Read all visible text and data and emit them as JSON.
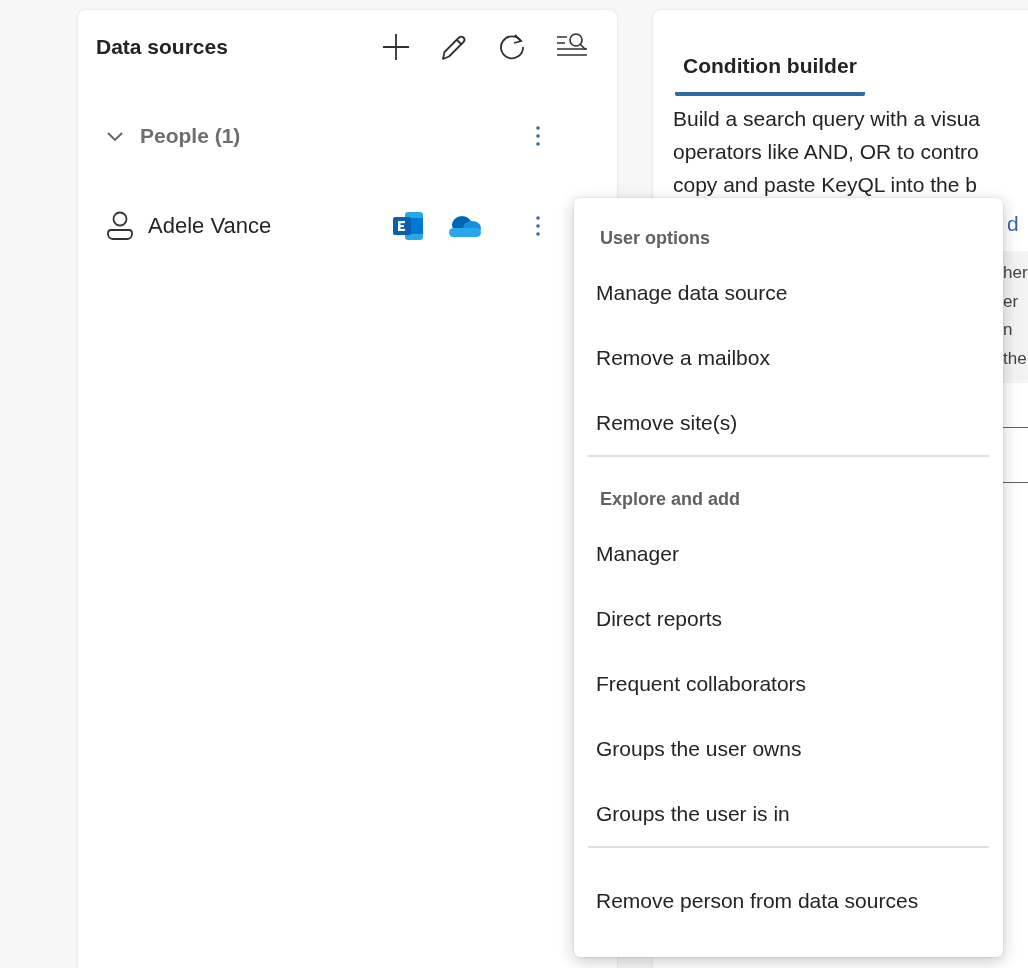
{
  "data_sources": {
    "title": "Data sources",
    "toolbar": [
      {
        "kind": "add"
      },
      {
        "kind": "edit"
      },
      {
        "kind": "refresh"
      },
      {
        "kind": "search"
      }
    ],
    "groups": [
      {
        "label": "People (1)",
        "expanded": true,
        "items": [
          {
            "name": "Adele Vance",
            "sources": [
              {
                "kind": "exchange"
              },
              {
                "kind": "onedrive"
              }
            ]
          }
        ]
      }
    ]
  },
  "condition_builder": {
    "tabs": [
      {
        "label": "Condition builder",
        "selected": true
      }
    ],
    "lines": [
      "Build a search query with a visua",
      "operators like AND, OR to contro",
      "copy and paste KeyQL into the b"
    ],
    "link_fragment": "d",
    "note_fragments": [
      "her",
      "er",
      "n",
      "the"
    ]
  },
  "context_menu": {
    "sections": [
      {
        "header": "User options",
        "items": [
          "Manage data source",
          "Remove a mailbox",
          "Remove site(s)"
        ]
      },
      {
        "header": "Explore and add",
        "items": [
          "Manager",
          "Direct reports",
          "Frequent collaborators",
          "Groups the user owns",
          "Groups the user is in"
        ]
      },
      {
        "items": [
          "Remove person from data sources"
        ]
      }
    ]
  }
}
